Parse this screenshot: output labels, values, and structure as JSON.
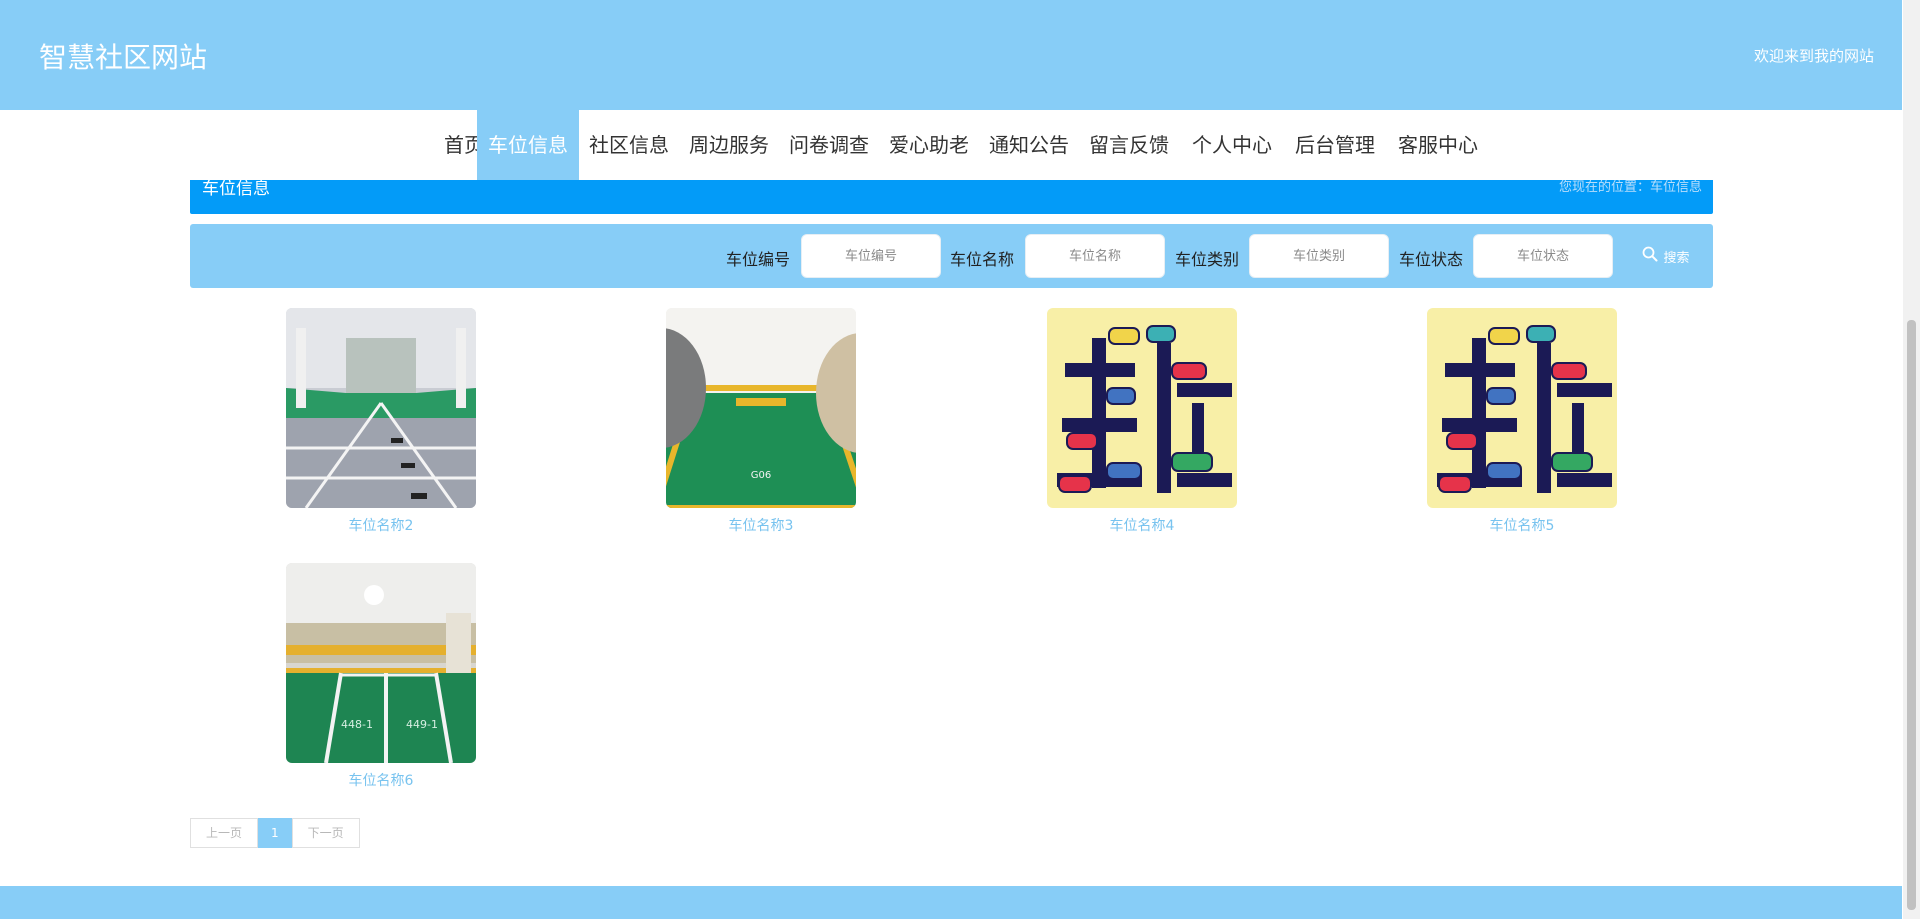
{
  "header": {
    "site_title": "智慧社区网站",
    "welcome_text": "欢迎来到我的网站"
  },
  "nav": {
    "items": [
      {
        "label": "首页"
      },
      {
        "label": "车位信息",
        "active": true
      },
      {
        "label": "社区信息"
      },
      {
        "label": "周边服务"
      },
      {
        "label": "问卷调查"
      },
      {
        "label": "爱心助老"
      },
      {
        "label": "通知公告"
      },
      {
        "label": "留言反馈"
      },
      {
        "label": "个人中心"
      },
      {
        "label": "后台管理"
      },
      {
        "label": "客服中心"
      }
    ]
  },
  "breadcrumb": {
    "title": "车位信息",
    "location": "您现在的位置：车位信息"
  },
  "search": {
    "fields": [
      {
        "label": "车位编号",
        "placeholder": "车位编号",
        "value": ""
      },
      {
        "label": "车位名称",
        "placeholder": "车位名称",
        "value": ""
      },
      {
        "label": "车位类别",
        "placeholder": "车位类别",
        "value": ""
      },
      {
        "label": "车位状态",
        "placeholder": "车位状态",
        "value": ""
      }
    ],
    "button_label": "搜索",
    "button_icon": "search-icon"
  },
  "cards": [
    {
      "name": "车位名称2",
      "image": "parking-garage-photo"
    },
    {
      "name": "车位名称3",
      "image": "parking-space-photo"
    },
    {
      "name": "车位名称4",
      "image": "parking-illustration"
    },
    {
      "name": "车位名称5",
      "image": "parking-illustration"
    },
    {
      "name": "车位名称6",
      "image": "parking-lot-photo"
    }
  ],
  "pagination": {
    "prev_label": "上一页",
    "current_page": "1",
    "next_label": "下一页"
  },
  "colors": {
    "primary": "#87cdf7",
    "breadcrumb_bg": "#039bf8",
    "card_name": "#78c3ef"
  }
}
